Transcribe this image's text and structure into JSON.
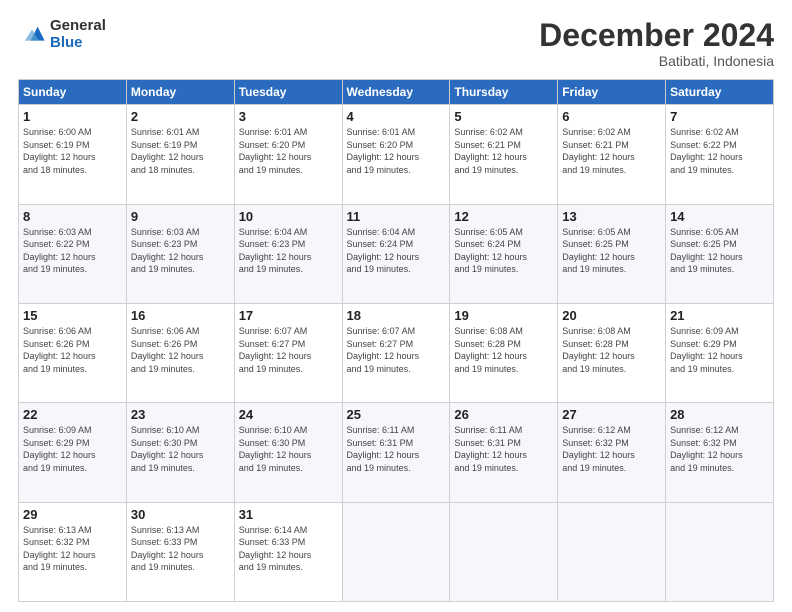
{
  "logo": {
    "general": "General",
    "blue": "Blue"
  },
  "header": {
    "month": "December 2024",
    "location": "Batibati, Indonesia"
  },
  "weekdays": [
    "Sunday",
    "Monday",
    "Tuesday",
    "Wednesday",
    "Thursday",
    "Friday",
    "Saturday"
  ],
  "weeks": [
    [
      {
        "day": "1",
        "sunrise": "6:00 AM",
        "sunset": "6:19 PM",
        "daylight": "12 hours",
        "minutes": "18"
      },
      {
        "day": "2",
        "sunrise": "6:01 AM",
        "sunset": "6:19 PM",
        "daylight": "12 hours",
        "minutes": "18"
      },
      {
        "day": "3",
        "sunrise": "6:01 AM",
        "sunset": "6:20 PM",
        "daylight": "12 hours",
        "minutes": "19"
      },
      {
        "day": "4",
        "sunrise": "6:01 AM",
        "sunset": "6:20 PM",
        "daylight": "12 hours",
        "minutes": "19"
      },
      {
        "day": "5",
        "sunrise": "6:02 AM",
        "sunset": "6:21 PM",
        "daylight": "12 hours",
        "minutes": "19"
      },
      {
        "day": "6",
        "sunrise": "6:02 AM",
        "sunset": "6:21 PM",
        "daylight": "12 hours",
        "minutes": "19"
      },
      {
        "day": "7",
        "sunrise": "6:02 AM",
        "sunset": "6:22 PM",
        "daylight": "12 hours",
        "minutes": "19"
      }
    ],
    [
      {
        "day": "8",
        "sunrise": "6:03 AM",
        "sunset": "6:22 PM",
        "daylight": "12 hours",
        "minutes": "19"
      },
      {
        "day": "9",
        "sunrise": "6:03 AM",
        "sunset": "6:23 PM",
        "daylight": "12 hours",
        "minutes": "19"
      },
      {
        "day": "10",
        "sunrise": "6:04 AM",
        "sunset": "6:23 PM",
        "daylight": "12 hours",
        "minutes": "19"
      },
      {
        "day": "11",
        "sunrise": "6:04 AM",
        "sunset": "6:24 PM",
        "daylight": "12 hours",
        "minutes": "19"
      },
      {
        "day": "12",
        "sunrise": "6:05 AM",
        "sunset": "6:24 PM",
        "daylight": "12 hours",
        "minutes": "19"
      },
      {
        "day": "13",
        "sunrise": "6:05 AM",
        "sunset": "6:25 PM",
        "daylight": "12 hours",
        "minutes": "19"
      },
      {
        "day": "14",
        "sunrise": "6:05 AM",
        "sunset": "6:25 PM",
        "daylight": "12 hours",
        "minutes": "19"
      }
    ],
    [
      {
        "day": "15",
        "sunrise": "6:06 AM",
        "sunset": "6:26 PM",
        "daylight": "12 hours",
        "minutes": "19"
      },
      {
        "day": "16",
        "sunrise": "6:06 AM",
        "sunset": "6:26 PM",
        "daylight": "12 hours",
        "minutes": "19"
      },
      {
        "day": "17",
        "sunrise": "6:07 AM",
        "sunset": "6:27 PM",
        "daylight": "12 hours",
        "minutes": "19"
      },
      {
        "day": "18",
        "sunrise": "6:07 AM",
        "sunset": "6:27 PM",
        "daylight": "12 hours",
        "minutes": "19"
      },
      {
        "day": "19",
        "sunrise": "6:08 AM",
        "sunset": "6:28 PM",
        "daylight": "12 hours",
        "minutes": "19"
      },
      {
        "day": "20",
        "sunrise": "6:08 AM",
        "sunset": "6:28 PM",
        "daylight": "12 hours",
        "minutes": "19"
      },
      {
        "day": "21",
        "sunrise": "6:09 AM",
        "sunset": "6:29 PM",
        "daylight": "12 hours",
        "minutes": "19"
      }
    ],
    [
      {
        "day": "22",
        "sunrise": "6:09 AM",
        "sunset": "6:29 PM",
        "daylight": "12 hours",
        "minutes": "19"
      },
      {
        "day": "23",
        "sunrise": "6:10 AM",
        "sunset": "6:30 PM",
        "daylight": "12 hours",
        "minutes": "19"
      },
      {
        "day": "24",
        "sunrise": "6:10 AM",
        "sunset": "6:30 PM",
        "daylight": "12 hours",
        "minutes": "19"
      },
      {
        "day": "25",
        "sunrise": "6:11 AM",
        "sunset": "6:31 PM",
        "daylight": "12 hours",
        "minutes": "19"
      },
      {
        "day": "26",
        "sunrise": "6:11 AM",
        "sunset": "6:31 PM",
        "daylight": "12 hours",
        "minutes": "19"
      },
      {
        "day": "27",
        "sunrise": "6:12 AM",
        "sunset": "6:32 PM",
        "daylight": "12 hours",
        "minutes": "19"
      },
      {
        "day": "28",
        "sunrise": "6:12 AM",
        "sunset": "6:32 PM",
        "daylight": "12 hours",
        "minutes": "19"
      }
    ],
    [
      {
        "day": "29",
        "sunrise": "6:13 AM",
        "sunset": "6:32 PM",
        "daylight": "12 hours",
        "minutes": "19"
      },
      {
        "day": "30",
        "sunrise": "6:13 AM",
        "sunset": "6:33 PM",
        "daylight": "12 hours",
        "minutes": "19"
      },
      {
        "day": "31",
        "sunrise": "6:14 AM",
        "sunset": "6:33 PM",
        "daylight": "12 hours",
        "minutes": "19"
      },
      null,
      null,
      null,
      null
    ]
  ]
}
